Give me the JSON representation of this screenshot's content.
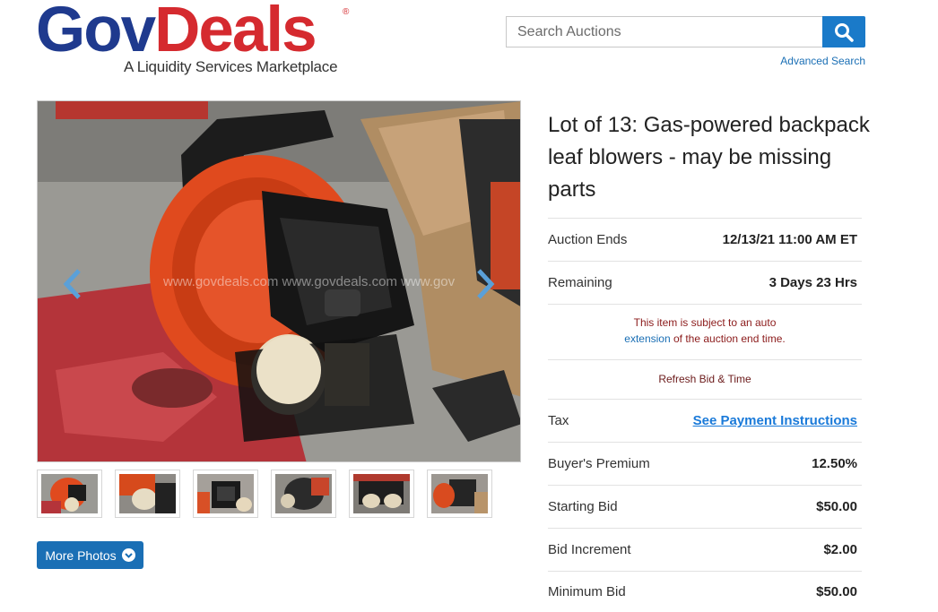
{
  "header": {
    "logo_gov": "Gov",
    "logo_deals": "Deals",
    "logo_tagline": "A Liquidity Services Marketplace",
    "search_placeholder": "Search Auctions",
    "search_icon": "search-icon",
    "advanced_search": "Advanced Search"
  },
  "colors": {
    "brand_blue": "#1f3a8e",
    "brand_red": "#d52a2f",
    "button_blue": "#1a6fb5",
    "link_blue": "#1a7ad9",
    "notice_red": "#8b1a1a"
  },
  "gallery": {
    "watermark": "www.govdeals.com www.govdeals.com www.gov",
    "prev_icon": "chevron-left-icon",
    "next_icon": "chevron-right-icon",
    "thumbnail_count": 6,
    "more_photos_label": "More Photos",
    "more_photos_icon": "circle-chevron-down-icon"
  },
  "lot": {
    "title": "Lot of 13: Gas-powered backpack leaf blowers - may be missing parts",
    "auction_ends_label": "Auction Ends",
    "auction_ends_value": "12/13/21 11:00 AM ET",
    "remaining_label": "Remaining",
    "remaining_value": "3 Days 23 Hrs",
    "notice_part1": "This item is subject to an auto",
    "notice_link": "extension",
    "notice_part2": "of the auction end time.",
    "refresh_label": "Refresh Bid & Time",
    "tax_label": "Tax",
    "tax_value": "See Payment Instructions",
    "buyers_premium_label": "Buyer's Premium",
    "buyers_premium_value": "12.50%",
    "starting_bid_label": "Starting Bid",
    "starting_bid_value": "$50.00",
    "bid_increment_label": "Bid Increment",
    "bid_increment_value": "$2.00",
    "minimum_bid_label": "Minimum Bid",
    "minimum_bid_value": "$50.00"
  }
}
